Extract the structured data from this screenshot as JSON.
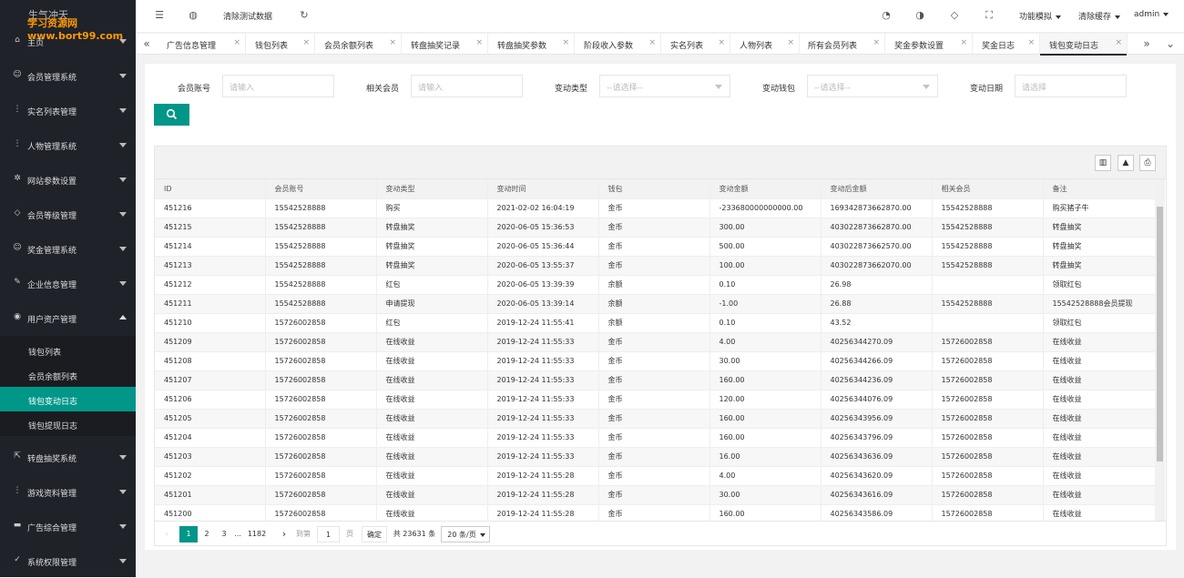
{
  "brand": {
    "line1": "生气冲天",
    "line2": "学习资源网www.bort99.com"
  },
  "sidebar": {
    "items": [
      {
        "label": "主页",
        "icon": "home-icon"
      },
      {
        "label": "会员管理系统",
        "icon": "users-icon"
      },
      {
        "label": "实名列表管理",
        "icon": "more-icon"
      },
      {
        "label": "人物管理系统",
        "icon": "more-icon"
      },
      {
        "label": "网站参数设置",
        "icon": "gear-icon"
      },
      {
        "label": "会员等级管理",
        "icon": "diamond-icon"
      },
      {
        "label": "奖金管理系统",
        "icon": "smile-icon"
      },
      {
        "label": "企业信息管理",
        "icon": "edit-icon"
      },
      {
        "label": "用户资产管理",
        "icon": "compass-icon"
      },
      {
        "label": "转盘抽奖系统",
        "icon": "share-icon"
      },
      {
        "label": "游戏资料管理",
        "icon": "more-icon"
      },
      {
        "label": "广告综合管理",
        "icon": "chat-icon"
      },
      {
        "label": "系统权限管理",
        "icon": "check-circle-icon"
      }
    ],
    "sub_items": [
      {
        "label": "钱包列表"
      },
      {
        "label": "会员余额列表"
      },
      {
        "label": "钱包变动日志"
      },
      {
        "label": "钱包提现日志"
      }
    ]
  },
  "topbar": {
    "clear_test_data": "清除测试数据",
    "function_mode": "功能模拟",
    "clear_cache": "清除缓存",
    "user": "admin"
  },
  "tabs": [
    {
      "label": "广告信息管理"
    },
    {
      "label": "钱包列表"
    },
    {
      "label": "会员余额列表"
    },
    {
      "label": "转盘抽奖记录"
    },
    {
      "label": "转盘抽奖参数"
    },
    {
      "label": "阶段收入参数"
    },
    {
      "label": "实名列表"
    },
    {
      "label": "人物列表"
    },
    {
      "label": "所有会员列表"
    },
    {
      "label": "奖金参数设置"
    },
    {
      "label": "奖金日志"
    },
    {
      "label": "钱包变动日志"
    }
  ],
  "filters": {
    "member_account": {
      "label": "会员账号",
      "placeholder": "请输入"
    },
    "related_member": {
      "label": "相关会员",
      "placeholder": "请输入"
    },
    "change_type": {
      "label": "变动类型",
      "placeholder": "--请选择--"
    },
    "change_wallet": {
      "label": "变动钱包",
      "placeholder": "--请选择--"
    },
    "change_date": {
      "label": "变动日期",
      "placeholder": "请选择"
    }
  },
  "table": {
    "columns": [
      "ID",
      "会员账号",
      "变动类型",
      "变动时间",
      "钱包",
      "变动金额",
      "变动后金额",
      "相关会员",
      "备注"
    ],
    "rows": [
      [
        "451216",
        "15542528888",
        "购买",
        "2021-02-02 16:04:19",
        "金币",
        "-233680000000000.00",
        "169342873662870.00",
        "15542528888",
        "购买猪子牛"
      ],
      [
        "451215",
        "15542528888",
        "转盘抽奖",
        "2020-06-05 15:36:53",
        "金币",
        "300.00",
        "403022873662870.00",
        "15542528888",
        "转盘抽奖"
      ],
      [
        "451214",
        "15542528888",
        "转盘抽奖",
        "2020-06-05 15:36:44",
        "金币",
        "500.00",
        "403022873662570.00",
        "15542528888",
        "转盘抽奖"
      ],
      [
        "451213",
        "15542528888",
        "转盘抽奖",
        "2020-06-05 13:55:37",
        "金币",
        "100.00",
        "403022873662070.00",
        "15542528888",
        "转盘抽奖"
      ],
      [
        "451212",
        "15542528888",
        "红包",
        "2020-06-05 13:39:39",
        "余额",
        "0.10",
        "26.98",
        "",
        "领取红包"
      ],
      [
        "451211",
        "15542528888",
        "申请提现",
        "2020-06-05 13:39:14",
        "余额",
        "-1.00",
        "26.88",
        "15542528888",
        "15542528888会员提现"
      ],
      [
        "451210",
        "15726002858",
        "红包",
        "2019-12-24 11:55:41",
        "余额",
        "0.10",
        "43.52",
        "",
        "领取红包"
      ],
      [
        "451209",
        "15726002858",
        "在线收益",
        "2019-12-24 11:55:33",
        "金币",
        "4.00",
        "40256344270.09",
        "15726002858",
        "在线收益"
      ],
      [
        "451208",
        "15726002858",
        "在线收益",
        "2019-12-24 11:55:33",
        "金币",
        "30.00",
        "40256344266.09",
        "15726002858",
        "在线收益"
      ],
      [
        "451207",
        "15726002858",
        "在线收益",
        "2019-12-24 11:55:33",
        "金币",
        "160.00",
        "40256344236.09",
        "15726002858",
        "在线收益"
      ],
      [
        "451206",
        "15726002858",
        "在线收益",
        "2019-12-24 11:55:33",
        "金币",
        "120.00",
        "40256344076.09",
        "15726002858",
        "在线收益"
      ],
      [
        "451205",
        "15726002858",
        "在线收益",
        "2019-12-24 11:55:33",
        "金币",
        "160.00",
        "40256343956.09",
        "15726002858",
        "在线收益"
      ],
      [
        "451204",
        "15726002858",
        "在线收益",
        "2019-12-24 11:55:33",
        "金币",
        "160.00",
        "40256343796.09",
        "15726002858",
        "在线收益"
      ],
      [
        "451203",
        "15726002858",
        "在线收益",
        "2019-12-24 11:55:33",
        "金币",
        "16.00",
        "40256343636.09",
        "15726002858",
        "在线收益"
      ],
      [
        "451202",
        "15726002858",
        "在线收益",
        "2019-12-24 11:55:28",
        "金币",
        "4.00",
        "40256343620.09",
        "15726002858",
        "在线收益"
      ],
      [
        "451201",
        "15726002858",
        "在线收益",
        "2019-12-24 11:55:28",
        "金币",
        "30.00",
        "40256343616.09",
        "15726002858",
        "在线收益"
      ],
      [
        "451200",
        "15726002858",
        "在线收益",
        "2019-12-24 11:55:28",
        "金币",
        "160.00",
        "40256343586.09",
        "15726002858",
        "在线收益"
      ]
    ]
  },
  "pager": {
    "p1": "1",
    "p2": "2",
    "p3": "3",
    "ellipsis": "...",
    "last": "1182",
    "goto": "到第",
    "goto_value": "1",
    "page_unit": "页",
    "confirm": "确定",
    "total": "共 23631 条",
    "per_page": "20 条/页"
  }
}
